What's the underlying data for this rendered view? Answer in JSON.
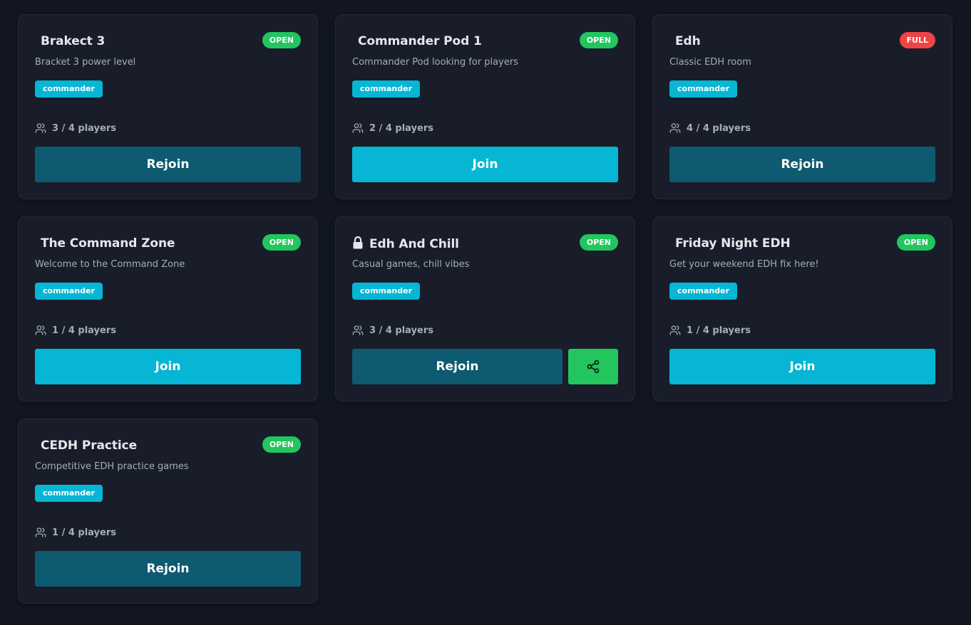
{
  "rooms": [
    {
      "name": "Brakect 3",
      "description": "Bracket 3 power level",
      "status": "OPEN",
      "tag": "commander",
      "players": "3 / 4 players",
      "action": "Rejoin",
      "locked": false,
      "share": false
    },
    {
      "name": "Commander Pod 1",
      "description": "Commander Pod looking for players",
      "status": "OPEN",
      "tag": "commander",
      "players": "2 / 4 players",
      "action": "Join",
      "locked": false,
      "share": false
    },
    {
      "name": "Edh",
      "description": "Classic EDH room",
      "status": "FULL",
      "tag": "commander",
      "players": "4 / 4 players",
      "action": "Rejoin",
      "locked": false,
      "share": false
    },
    {
      "name": "The Command Zone",
      "description": "Welcome to the Command Zone",
      "status": "OPEN",
      "tag": "commander",
      "players": "1 / 4 players",
      "action": "Join",
      "locked": false,
      "share": false
    },
    {
      "name": "Edh And Chill",
      "description": "Casual games, chill vibes",
      "status": "OPEN",
      "tag": "commander",
      "players": "3 / 4 players",
      "action": "Rejoin",
      "locked": true,
      "share": true
    },
    {
      "name": "Friday Night EDH",
      "description": "Get your weekend EDH fix here!",
      "status": "OPEN",
      "tag": "commander",
      "players": "1 / 4 players",
      "action": "Join",
      "locked": false,
      "share": false
    },
    {
      "name": "CEDH Practice",
      "description": "Competitive EDH practice games",
      "status": "OPEN",
      "tag": "commander",
      "players": "1 / 4 players",
      "action": "Rejoin",
      "locked": false,
      "share": false
    }
  ],
  "colors": {
    "background": "#111620",
    "card": "#181d29",
    "open": "#22c55e",
    "full": "#ef4444",
    "accent": "#06b6d4",
    "rejoin": "#0e5a70"
  },
  "icons": {
    "players": "users-icon",
    "locked": "lock-icon",
    "share": "share-icon"
  }
}
